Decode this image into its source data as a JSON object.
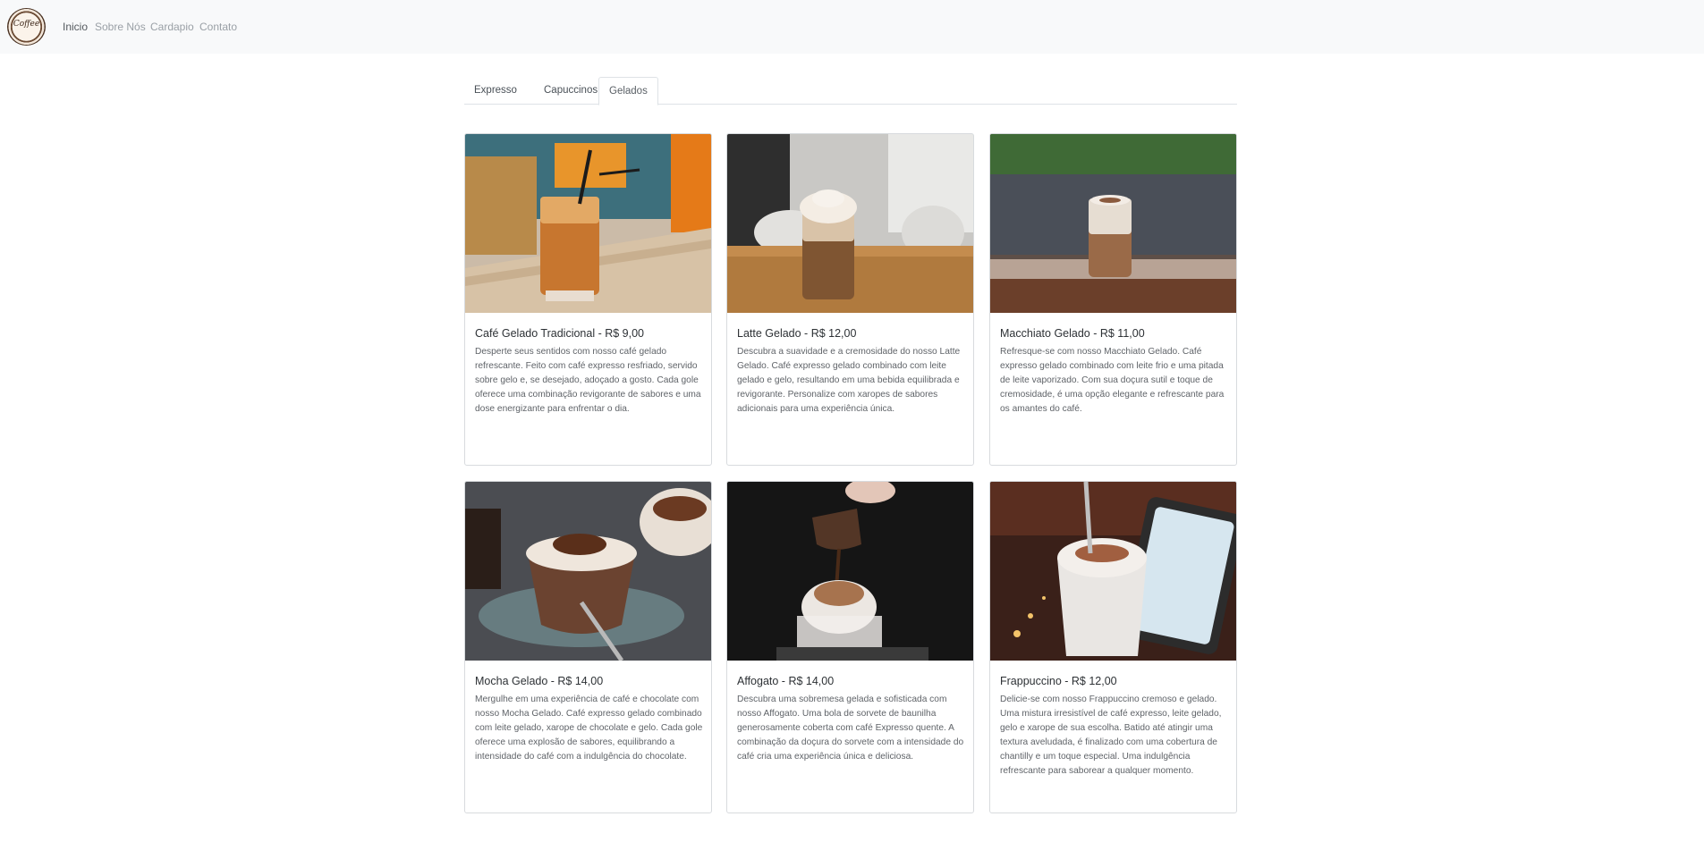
{
  "brand": {
    "logo_text": "Coffee"
  },
  "nav": {
    "items": [
      {
        "label": "Inicio",
        "active": true
      },
      {
        "label": "Sobre Nós",
        "active": false
      },
      {
        "label": "Cardapio",
        "active": false
      },
      {
        "label": "Contato",
        "active": false
      }
    ]
  },
  "tabs": [
    {
      "label": "Expresso",
      "active": false
    },
    {
      "label": "Capuccinos",
      "active": false
    },
    {
      "label": "Gelados",
      "active": true
    }
  ],
  "cards": [
    {
      "title": "Café Gelado Tradicional - R$ 9,00",
      "text": "Desperte seus sentidos com nosso café gelado refrescante. Feito com café expresso resfriado, servido sobre gelo e, se desejado, adoçado a gosto. Cada gole oferece uma combinação revigorante de sabores e uma dose energizante para enfrentar o dia."
    },
    {
      "title": "Latte Gelado - R$ 12,00",
      "text": "Descubra a suavidade e a cremosidade do nosso Latte Gelado. Café expresso gelado combinado com leite gelado e gelo, resultando em uma bebida equilibrada e revigorante. Personalize com xaropes de sabores adicionais para uma experiência única."
    },
    {
      "title": "Macchiato Gelado - R$ 11,00",
      "text": "Refresque-se com nosso Macchiato Gelado. Café expresso gelado combinado com leite frio e uma pitada de leite vaporizado. Com sua doçura sutil e toque de cremosidade, é uma opção elegante e refrescante para os amantes do café."
    },
    {
      "title": "Mocha Gelado - R$ 14,00",
      "text": "Mergulhe em uma experiência de café e chocolate com nosso Mocha Gelado. Café expresso gelado combinado com leite gelado, xarope de chocolate e gelo. Cada gole oferece uma explosão de sabores, equilibrando a intensidade do café com a indulgência do chocolate."
    },
    {
      "title": "Affogato - R$ 14,00",
      "text": "Descubra uma sobremesa gelada e sofisticada com nosso Affogato. Uma bola de sorvete de baunilha generosamente coberta com café Expresso quente. A combinação da doçura do sorvete com a intensidade do café cria uma experiência única e deliciosa."
    },
    {
      "title": "Frappuccino - R$ 12,00",
      "text": "Delicie-se com nosso Frappuccino cremoso e gelado. Uma mistura irresistível de café expresso, leite gelado, gelo e xarope de sua escolha. Batido até atingir uma textura aveludada, é finalizado com uma cobertura de chantilly e um toque especial. Uma indulgência refrescante para saborear a qualquer momento."
    }
  ]
}
